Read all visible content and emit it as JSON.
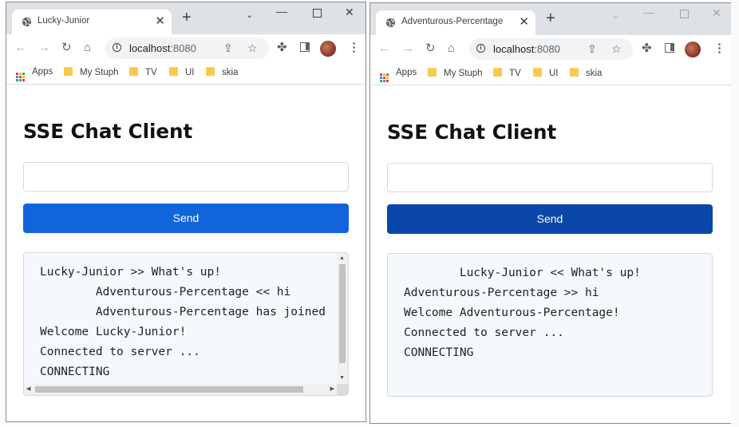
{
  "windows": [
    {
      "tab_title": "Lucky-Junior",
      "tab_close": "✕",
      "new_tab": "+",
      "url_host": "localhost",
      "url_port": ":8080",
      "bookmarks": [
        "Apps",
        "My Stuph",
        "TV",
        "UI",
        "skia"
      ],
      "heading": "SSE Chat Client",
      "input_value": "",
      "send_label": "Send",
      "send_color": "#1264dc",
      "log_lines": [
        "Lucky-Junior >> What's up!",
        "        Adventurous-Percentage << hi",
        "        Adventurous-Percentage has joined",
        "Welcome Lucky-Junior!",
        "Connected to server ...",
        "CONNECTING"
      ]
    },
    {
      "tab_title": "Adventurous-Percentage",
      "tab_close": "✕",
      "new_tab": "+",
      "url_host": "localhost",
      "url_port": ":8080",
      "bookmarks": [
        "Apps",
        "My Stuph",
        "TV",
        "UI",
        "skia"
      ],
      "heading": "SSE Chat Client",
      "input_value": "",
      "send_label": "Send",
      "send_color": "#0b47a8",
      "log_lines": [
        "        Lucky-Junior << What's up!",
        "Adventurous-Percentage >> hi",
        "Welcome Adventurous-Percentage!",
        "Connected to server ...",
        "CONNECTING"
      ]
    }
  ],
  "colors": {
    "titlebar": "#dee1e6",
    "log_background": "#f5f8fd",
    "folder": "#f7cb4d"
  }
}
